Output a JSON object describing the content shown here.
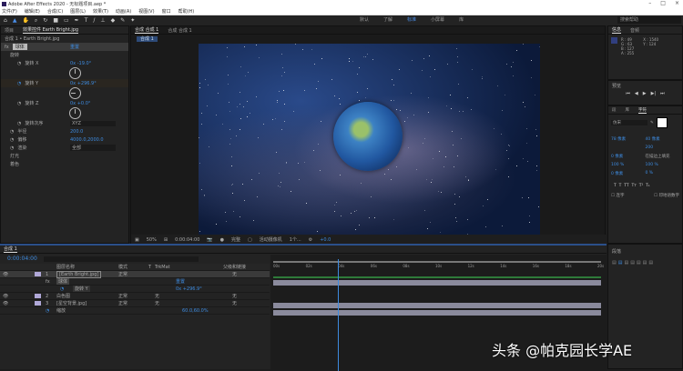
{
  "title": "Adobe After Effects 2020 - 无标题项目.aep *",
  "window_buttons": [
    "–",
    "□",
    "×"
  ],
  "menu": [
    "文件(F)",
    "编辑(E)",
    "合成(C)",
    "图层(L)",
    "效果(T)",
    "动画(A)",
    "视图(V)",
    "窗口",
    "帮助(H)"
  ],
  "workspaces": [
    "默认",
    "了解",
    "标准",
    "小屏幕",
    "库"
  ],
  "active_workspace": "标准",
  "search_placeholder": "搜索帮助",
  "effects_panel": {
    "tabs": [
      "项目",
      "效果控件 Earth Bright.jpg"
    ],
    "layer": "合成 1 • Earth Bright.jpg",
    "effect_name": "球体",
    "reset": "重置",
    "rows": [
      {
        "label": "旋转"
      },
      {
        "label": "旋转 X",
        "value": "0x -19.0°"
      },
      {
        "label": "旋转 Y",
        "value": "0x +296.9°"
      },
      {
        "label": "旋转 Z",
        "value": "0x +0.0°"
      },
      {
        "label": "旋转次序",
        "value": "XYZ"
      },
      {
        "label": "半径",
        "value": "200.0"
      },
      {
        "label": "偏移",
        "value": "4000.0,2000.0"
      },
      {
        "label": "渲染",
        "value": "全部"
      },
      {
        "label": "灯光"
      },
      {
        "label": "着色"
      }
    ]
  },
  "viewer": {
    "tabs": [
      "合成 合成 1",
      "合成 合成 1"
    ],
    "breadcrumb": "合成 1",
    "zoom": "50%",
    "time": "0:00:04:00",
    "quality": "完整",
    "camera": "活动摄像机",
    "views": "1个...",
    "exposure": "+0.0"
  },
  "info_panel": {
    "tabs": [
      "信息",
      "音频"
    ],
    "r": "R : 49",
    "g": "G : 63",
    "b": "B : 127",
    "a": "A : 255",
    "x": "X : 1540",
    "y": "Y : 124"
  },
  "preview_panel": {
    "title": "预览"
  },
  "character_panel": {
    "tabs": [
      "段",
      "库",
      "字符"
    ],
    "font": "仿宋",
    "size": "78 像素",
    "leading": "40 像素",
    "tracking": "200",
    "stroke": "0 像素",
    "stroke_type": "在描边上填充",
    "vscale": "100 %",
    "hscale": "100 %",
    "baseline": "0 像素",
    "tsume": "0 %",
    "ligature": "连字",
    "hindi": "印地语数字"
  },
  "paragraph_panel": {
    "title": "段落"
  },
  "timeline": {
    "tab": "合成 1",
    "timecode": "0:00:04:00",
    "search_placeholder": "",
    "headers": [
      "图层名称",
      "模式",
      "T",
      "TrkMat",
      "父级和链接"
    ],
    "layers": [
      {
        "num": "1",
        "name": "[Earth Bright.jpg]",
        "mode": "正常",
        "parent": "无"
      },
      {
        "num": "2",
        "name": "白色图",
        "mode": "正常",
        "trkmat": "无",
        "parent": "无"
      },
      {
        "num": "3",
        "name": "[星空背景.jpg]",
        "mode": "正常",
        "trkmat": "无",
        "parent": "无"
      }
    ],
    "sub_rows": [
      {
        "label": "球体",
        "value": "重置"
      },
      {
        "label": "旋转 Y",
        "value": "0x +296.9°"
      },
      {
        "label": "缩放",
        "value": "60.0,60.0%"
      }
    ],
    "ticks": [
      "00s",
      "02s",
      "04s",
      "06s",
      "08s",
      "10s",
      "12s",
      "14s",
      "16s",
      "18s",
      "20s"
    ],
    "playhead_fraction": 0.2
  },
  "watermark": "头条 @帕克园长学AE"
}
